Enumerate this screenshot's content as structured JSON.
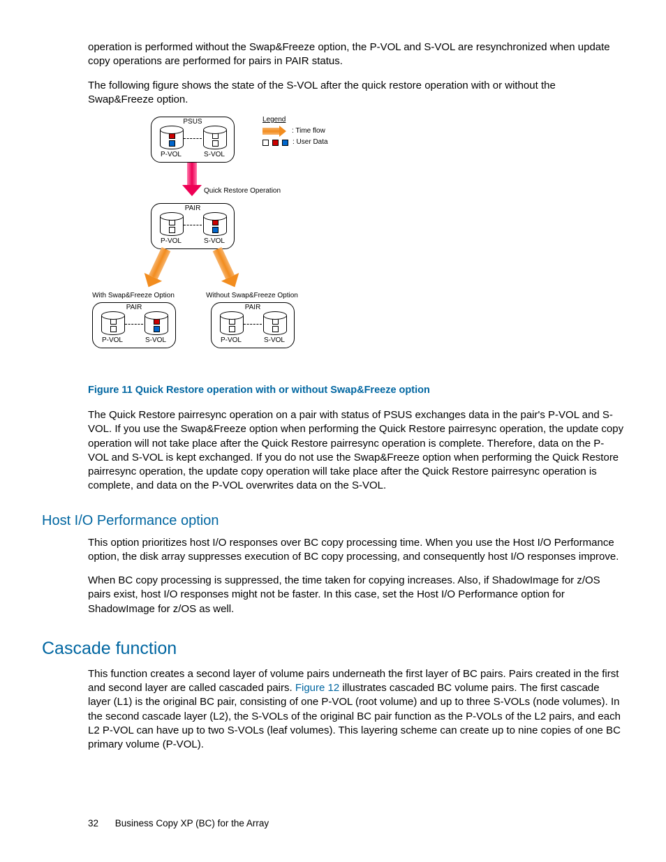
{
  "paragraphs": {
    "p1": "operation is performed without the Swap&Freeze option, the P-VOL and S-VOL are resynchronized when update copy operations are performed for pairs in PAIR status.",
    "p2": "The following figure shows the state of the S-VOL after the quick restore operation with or without the Swap&Freeze option.",
    "p3": "The Quick Restore pairresync operation on a pair with status of PSUS exchanges data in the pair's P-VOL and S-VOL. If you use the Swap&Freeze option when performing the Quick Restore pairresync operation, the update copy operation will not take place after the Quick Restore pairresync operation is complete. Therefore, data on the P-VOL and S-VOL is kept exchanged. If you do not use the Swap&Freeze option when performing the Quick Restore pairresync operation, the update copy operation will take place after the Quick Restore pairresync operation is complete, and data on the P-VOL overwrites data on the S-VOL.",
    "host_p1": "This option prioritizes host I/O responses over BC copy processing time. When you use the Host I/O Performance option, the disk array suppresses execution of BC copy processing, and consequently host I/O responses improve.",
    "host_p2": "When BC copy processing is suppressed, the time taken for copying increases. Also, if ShadowImage for z/OS pairs exist, host I/O responses might not be faster. In this case, set the Host I/O Performance option for ShadowImage for z/OS as well.",
    "cascade_p1a": "This function creates a second layer of volume pairs underneath the first layer of BC pairs. Pairs created in the first and second layer are called cascaded pairs. ",
    "cascade_xref": "Figure 12",
    "cascade_p1b": " illustrates cascaded BC volume pairs. The first cascade layer (L1) is the original BC pair, consisting of one P-VOL (root volume) and up to three S-VOLs (node volumes). In the second cascade layer (L2), the S-VOLs of the original BC pair function as the P-VOLs of the L2 pairs, and each L2 P-VOL can have up to two S-VOLs (leaf volumes). This layering scheme can create up to nine copies of one BC primary volume (P-VOL)."
  },
  "figure_caption": "Figure 11 Quick Restore operation with or without Swap&Freeze option",
  "headings": {
    "host": "Host I/O Performance option",
    "cascade": "Cascade function"
  },
  "diagram": {
    "legend_title": "Legend",
    "legend_time": ": Time flow",
    "legend_user": ": User Data",
    "status_psus": "PSUS",
    "status_pair": "PAIR",
    "pvol": "P-VOL",
    "svol": "S-VOL",
    "op": "Quick Restore Operation",
    "with": "With Swap&Freeze Option",
    "without": "Without Swap&Freeze Option"
  },
  "footer": {
    "page": "32",
    "title": "Business Copy XP (BC) for the Array"
  }
}
